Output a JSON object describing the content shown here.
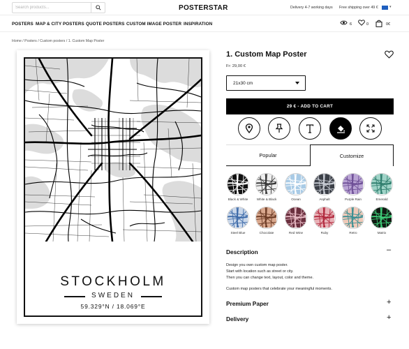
{
  "header": {
    "search_placeholder": "Search products...",
    "logo": "POSTERSTAR",
    "delivery_note": "Delivery 4-7 working days",
    "shipping_note": "Free shipping over 49 €",
    "flag_color": "#1f5fbf"
  },
  "nav": {
    "items": [
      "POSTERS",
      "MAP & CITY POSTERS",
      "QUOTE POSTERS",
      "CUSTOM IMAGE POSTER",
      "INSPIRATION"
    ],
    "views_count": "6",
    "wishlist_count": "0",
    "cart_total": "0€"
  },
  "breadcrumb": "Home / Posters / Custom posters / 1. Custom Map Poster",
  "poster": {
    "city": "STOCKHOLM",
    "country": "SWEDEN",
    "coordinates": "59.329°N / 18.069°E"
  },
  "product": {
    "title": "1. Custom Map Poster",
    "price": "Fr: 29,00 €",
    "size_selected": "21x30 cm",
    "add_to_cart": "29 € - ADD TO CART"
  },
  "customize_icons": [
    "map-pin-icon",
    "push-pin-icon",
    "text-icon",
    "paint-bucket-icon",
    "expand-icon"
  ],
  "tabs": {
    "popular": "Popular",
    "customize": "Customize"
  },
  "themes": [
    {
      "name": "Black & White",
      "bg": "#111111",
      "line": "#ffffff"
    },
    {
      "name": "White & Black",
      "bg": "#eeeeee",
      "line": "#333333"
    },
    {
      "name": "Ocean",
      "bg": "#a9cbe6",
      "line": "#ffffff"
    },
    {
      "name": "Asphalt",
      "bg": "#3b3f47",
      "line": "#c8ccd4"
    },
    {
      "name": "Purple Rain",
      "bg": "#b9a4d4",
      "line": "#6e4f96"
    },
    {
      "name": "Emerald",
      "bg": "#9fd3c7",
      "line": "#2f7d6d"
    },
    {
      "name": "Steel Blue",
      "bg": "#c9d7ea",
      "line": "#3d6aa8"
    },
    {
      "name": "Chocolate",
      "bg": "#d9a88e",
      "line": "#6b3a24"
    },
    {
      "name": "Red Wine",
      "bg": "#6a2f3e",
      "line": "#e7b9c3"
    },
    {
      "name": "Ruby",
      "bg": "#e8b0b6",
      "line": "#b0263b"
    },
    {
      "name": "Retro",
      "bg": "#efc9b8",
      "line": "#3a8f93"
    },
    {
      "name": "Matrix",
      "bg": "#101a12",
      "line": "#3fd07a"
    }
  ],
  "description": {
    "title": "Description",
    "lines": [
      "Design you own custom map poster.",
      "Start with location such as street or city.",
      "Then you can change text, layout, color and theme."
    ],
    "tagline": "Custom map posters that celebrate your meaningful moments."
  },
  "sections": [
    {
      "title": "Premium Paper"
    },
    {
      "title": "Delivery"
    }
  ]
}
